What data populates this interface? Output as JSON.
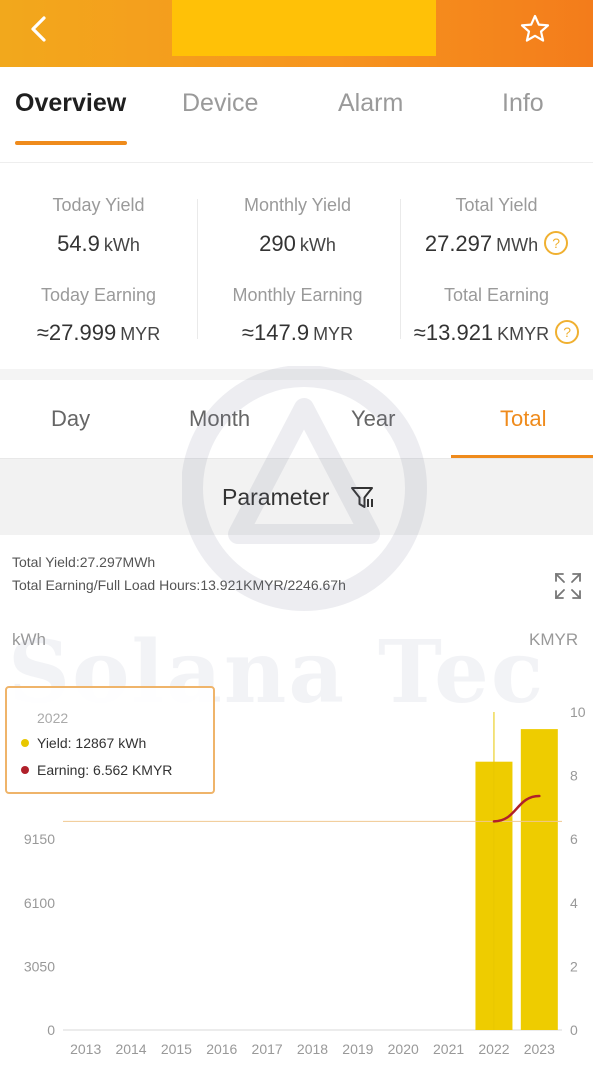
{
  "header": {
    "title": "",
    "back_icon": "chevron-left-icon",
    "favorite_icon": "star-outline-icon",
    "colors": {
      "gradient_start": "#f2a81c",
      "gradient_end": "#f37c1b",
      "title_block": "#ffc107"
    }
  },
  "main_tabs": [
    {
      "label": "Overview",
      "active": true
    },
    {
      "label": "Device",
      "active": false
    },
    {
      "label": "Alarm",
      "active": false
    },
    {
      "label": "Info",
      "active": false
    }
  ],
  "stats": {
    "today_yield": {
      "label": "Today Yield",
      "value": "54.9",
      "unit": "kWh"
    },
    "monthly_yield": {
      "label": "Monthly Yield",
      "value": "290",
      "unit": "kWh"
    },
    "total_yield": {
      "label": "Total Yield",
      "value": "27.297",
      "unit": "MWh",
      "help_icon": "question-circle-icon",
      "help_glyph": "?"
    },
    "today_earning": {
      "label": "Today Earning",
      "value": "≈27.999",
      "unit": "MYR"
    },
    "monthly_earning": {
      "label": "Monthly Earning",
      "value": "≈147.9",
      "unit": "MYR"
    },
    "total_earning": {
      "label": "Total Earning",
      "value": "≈13.921",
      "unit": "KMYR",
      "help_icon": "question-circle-icon",
      "help_glyph": "?"
    }
  },
  "period_tabs": [
    {
      "label": "Day",
      "active": false
    },
    {
      "label": "Month",
      "active": false
    },
    {
      "label": "Year",
      "active": false
    },
    {
      "label": "Total",
      "active": true
    }
  ],
  "parameter": {
    "label": "Parameter",
    "icon": "filter-icon"
  },
  "summary": {
    "line1": "Total Yield:27.297MWh",
    "line2": "Total Earning/Full Load Hours:13.921KMYR/2246.67h",
    "expand_icon": "fullscreen-icon"
  },
  "watermark": {
    "text": "Solana Tec",
    "logo_icon": "solana-logo-icon"
  },
  "tooltip": {
    "title": "2022",
    "yield_label": "Yield:",
    "yield_value": "12867 kWh",
    "earning_label": "Earning:",
    "earning_value": "6.562 KMYR",
    "yield_color": "#e8c700",
    "earning_color": "#b0202a"
  },
  "chart_data": {
    "type": "bar",
    "categories": [
      "2013",
      "2014",
      "2015",
      "2016",
      "2017",
      "2018",
      "2019",
      "2020",
      "2021",
      "2022",
      "2023"
    ],
    "series": [
      {
        "name": "Yield",
        "unit": "kWh",
        "axis": "left",
        "type": "bar",
        "color": "#eecc00",
        "values": [
          0,
          0,
          0,
          0,
          0,
          0,
          0,
          0,
          0,
          12867,
          14430
        ]
      },
      {
        "name": "Earning",
        "unit": "KMYR",
        "axis": "right",
        "type": "line",
        "color": "#b0202a",
        "values": [
          null,
          null,
          null,
          null,
          null,
          null,
          null,
          null,
          null,
          6.562,
          7.359
        ]
      }
    ],
    "y_left": {
      "label": "kWh",
      "ticks": [
        0,
        3050,
        6100,
        9150
      ],
      "range": [
        0,
        15250
      ]
    },
    "y_right": {
      "label": "KMYR",
      "ticks": [
        0,
        2,
        4,
        6,
        8,
        10
      ],
      "range": [
        0,
        10
      ]
    },
    "selected_category": "2022",
    "grid": false
  }
}
